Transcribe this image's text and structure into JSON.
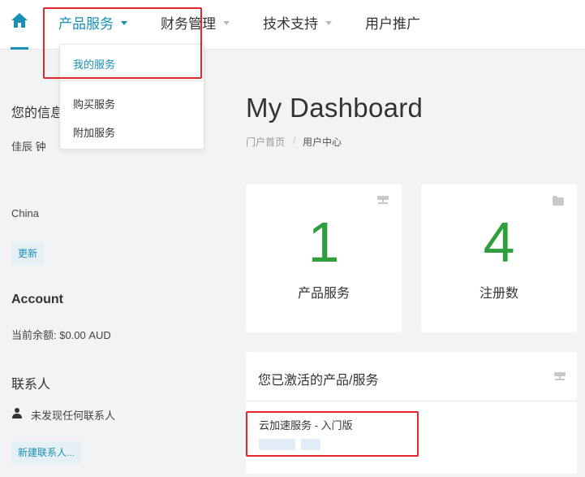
{
  "nav": {
    "items": [
      {
        "label": "产品服务",
        "active": true
      },
      {
        "label": "财务管理",
        "active": false
      },
      {
        "label": "技术支持",
        "active": false
      },
      {
        "label": "用户推广",
        "active": false
      }
    ],
    "accent_color": "#1a8fb3"
  },
  "dropdown": {
    "items": [
      {
        "label": "我的服务",
        "active": true
      },
      {
        "label": "购买服务",
        "active": false
      },
      {
        "label": "附加服务",
        "active": false
      }
    ]
  },
  "sidebar": {
    "info_title": "您的信息",
    "name": "佳辰 钟",
    "country": "China",
    "update_button": "更新",
    "account_title": "Account",
    "balance": "当前余额: $0.00 AUD",
    "contacts_title": "联系人",
    "no_contacts": "未发现任何联系人",
    "new_contact_button": "新建联系人..."
  },
  "main": {
    "title": "My Dashboard",
    "breadcrumb": {
      "home": "门户首页",
      "separator": "/",
      "current": "用户中心"
    },
    "stats": [
      {
        "value": "1",
        "label": "产品服务",
        "icon": "server-icon"
      },
      {
        "value": "4",
        "label": "注册数",
        "icon": "folder-icon"
      }
    ],
    "number_color": "#2f9e3c",
    "active_panel": {
      "title": "您已激活的产品/服务",
      "icon": "server-icon",
      "services": [
        {
          "name": "云加速服务 - 入门版"
        }
      ]
    }
  },
  "highlight_color": "#e4262d"
}
